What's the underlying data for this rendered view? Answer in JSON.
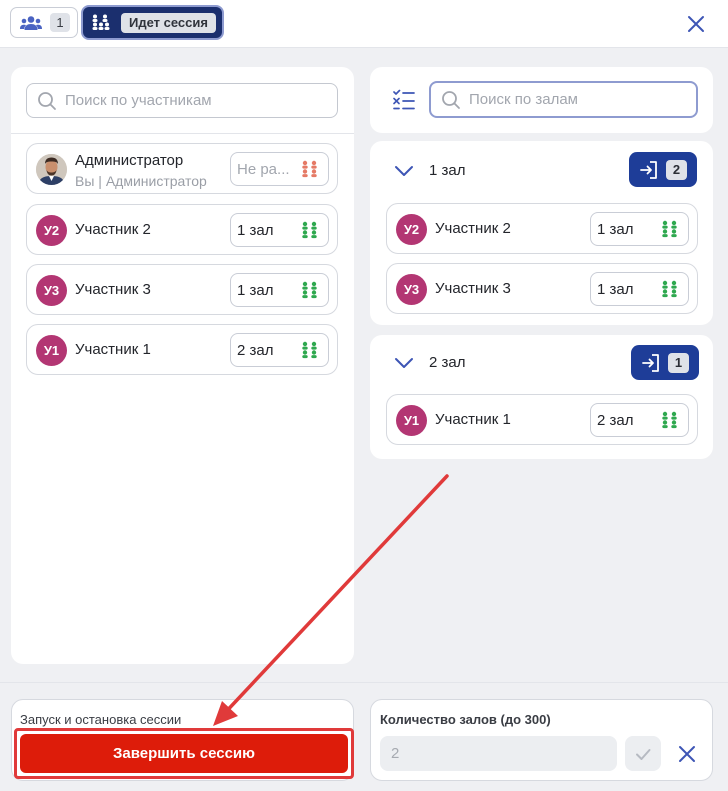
{
  "topbar": {
    "participants_tab": {
      "icon": "users-icon",
      "count": "1"
    },
    "session_tab": {
      "icon": "rooms-icon",
      "label": "Идет сессия"
    },
    "close_icon": "close-icon"
  },
  "participants_panel": {
    "search": {
      "placeholder": "Поиск по участникам",
      "value": ""
    },
    "rows": [
      {
        "avatar": "",
        "name": "Администратор",
        "subtitle": "Вы | Администратор",
        "hall": "Не ра...",
        "hall_icon_color": "#e57a66"
      },
      {
        "avatar": "У2",
        "name": "Участник 2",
        "hall": "1 зал",
        "hall_icon_color": "#2fa84f"
      },
      {
        "avatar": "У3",
        "name": "Участник 3",
        "hall": "1 зал",
        "hall_icon_color": "#2fa84f"
      },
      {
        "avatar": "У1",
        "name": "Участник 1",
        "hall": "2 зал",
        "hall_icon_color": "#2fa84f"
      }
    ]
  },
  "halls_panel": {
    "search": {
      "placeholder": "Поиск по залам",
      "value": ""
    },
    "halls": [
      {
        "title": "1 зал",
        "join_count": "2",
        "members": [
          {
            "avatar": "У2",
            "name": "Участник 2",
            "hall": "1 зал"
          },
          {
            "avatar": "У3",
            "name": "Участник 3",
            "hall": "1 зал"
          }
        ]
      },
      {
        "title": "2 зал",
        "join_count": "1",
        "members": [
          {
            "avatar": "У1",
            "name": "Участник 1",
            "hall": "2 зал"
          }
        ]
      }
    ]
  },
  "session_control": {
    "label": "Запуск и остановка сессии",
    "end_button": "Завершить сессию"
  },
  "halls_count": {
    "label": "Количество залов (до 300)",
    "value": "2"
  },
  "colors": {
    "accent": "#1e3d98",
    "danger": "#dd1c0a",
    "avatar": "#b33673",
    "annotation": "#e03a3a"
  }
}
